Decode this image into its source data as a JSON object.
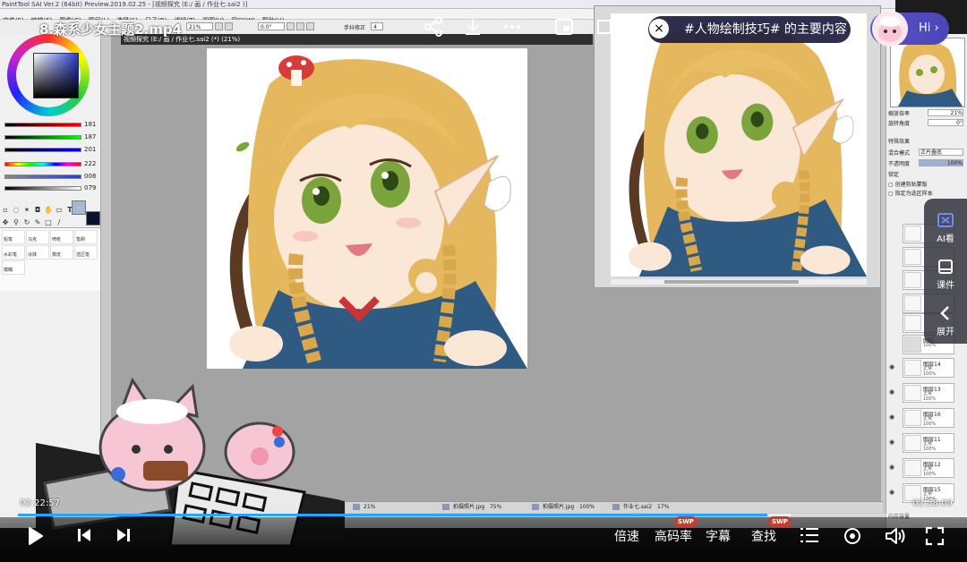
{
  "video": {
    "title": "8.森系少女主题2.mp4",
    "time_elapsed": "02:22:57",
    "time_total": "02:58:09",
    "progress": 0.805,
    "buffered": 0.83
  },
  "topic": {
    "text": "#人物绘制技巧# 的主要内容",
    "close_icon": "close-icon"
  },
  "assistant": {
    "greeting": "Hi",
    "chevron": "›"
  },
  "side_rail": {
    "ai_label": "AI看",
    "courseware_label": "课件",
    "expand_label": "展开"
  },
  "controls": {
    "speed_label": "倍速",
    "quality_label": "高码率",
    "subtitle_label": "字幕",
    "search_label": "查找",
    "swp_badge": "SWP"
  },
  "sai": {
    "window_title": "PaintTool SAI Ver.2 (64bit) Preview.2019.02.25 - [视频探究 (E:/ 画 / 作业七.sai2 )]",
    "menus": [
      "文件(F)",
      "编辑(E)",
      "图像(C)",
      "图层(L)",
      "选择(S)",
      "尺子(R)",
      "滤镜(T)",
      "视图(V)",
      "窗口(W)",
      "帮助(H)"
    ],
    "toolbar": {
      "zoom": "21%",
      "angle": "0.0°",
      "stabilizer_label": "手抖修正",
      "stabilizer_value": "4"
    },
    "canvas_tab": "视频探究 (E:/ 画 / 作业七.sai2 (*) (21%)",
    "color_values": [
      "181",
      "187",
      "201",
      "222",
      "008",
      "079"
    ],
    "brushes": [
      "铅笔",
      "马克",
      "喷枪",
      "笔刷",
      "水彩笔",
      "涂抹",
      "橡皮",
      "选区笔",
      "模糊"
    ],
    "right_panel": {
      "zoom_label": "缩放倍率",
      "zoom_value": "21%",
      "angle_label": "旋转角度",
      "angle_value": "0°",
      "effect_label": "特殊效果",
      "blend_label": "混合模式",
      "blend_value": "正片叠底",
      "opacity_label": "不透明度",
      "opacity_value": "100%",
      "lock_label": "锁定",
      "clip_label": "创建剪贴蒙版",
      "select_label": "指定为选区样本",
      "layers": [
        {
          "name": "图层14",
          "mode": "正常",
          "opacity": "100%"
        },
        {
          "name": "图层13",
          "mode": "正常",
          "opacity": "100%"
        },
        {
          "name": "图层16",
          "mode": "正常",
          "opacity": "100%"
        },
        {
          "name": "图层11",
          "mode": "正常",
          "opacity": "100%"
        },
        {
          "name": "图层12",
          "mode": "正常",
          "opacity": "100%"
        },
        {
          "name": "图层15",
          "mode": "正常",
          "opacity": "100%"
        }
      ],
      "group_label": "图层",
      "group_opacity": "100%",
      "bottom_label": "内存容量",
      "bottom_value": "96% (11%)"
    },
    "bottom_tabs": [
      {
        "name": "21%",
        "pct": ""
      },
      {
        "name": "拍摄照片.jpg",
        "pct": "75%"
      },
      {
        "name": "拍摄照片.jpg",
        "pct": "100%"
      },
      {
        "name": "作业七.sai2",
        "pct": "17%"
      }
    ]
  },
  "colors": {
    "accent": "#29a3ff",
    "topic_bg": "#1c1c40",
    "hi_bg": "#5b53c8",
    "swp": "#c43d2d"
  }
}
